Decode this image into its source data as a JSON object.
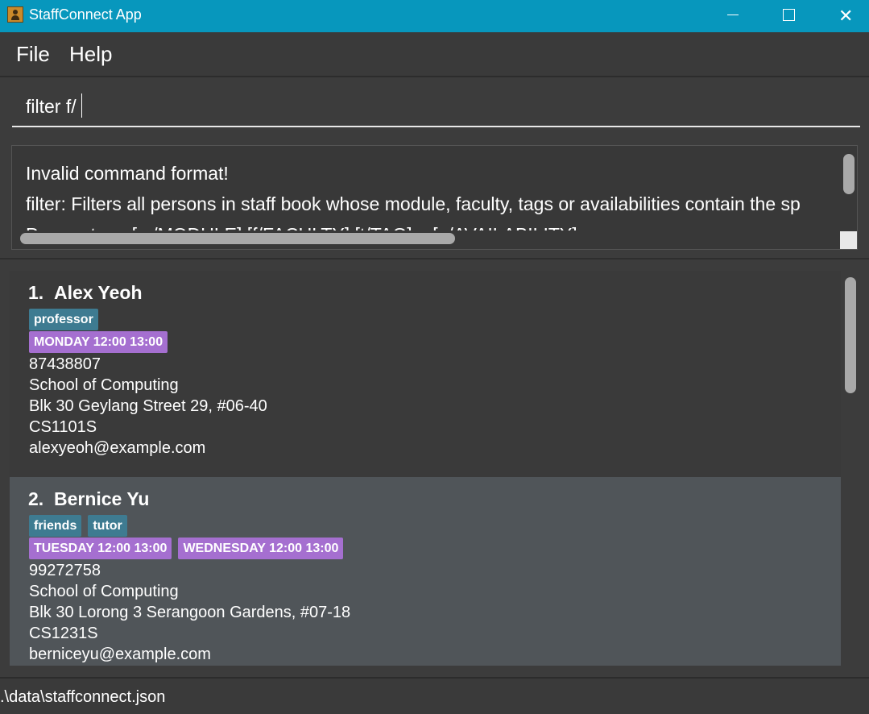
{
  "window": {
    "title": "StaffConnect App"
  },
  "menu": {
    "file": "File",
    "help": "Help"
  },
  "command": {
    "value": "filter f/"
  },
  "result": {
    "lines": [
      "Invalid command format!",
      "filter: Filters all persons in staff book whose module, faculty, tags or availabilities contain the sp",
      "Parameters: [m/MODULE] [f/FACULTY] [t/TAG]... [a/AVAILABILITY]..."
    ]
  },
  "persons": [
    {
      "index": "1.",
      "name": "Alex Yeoh",
      "tags": [
        "professor"
      ],
      "availabilities": [
        "MONDAY 12:00 13:00"
      ],
      "phone": "87438807",
      "faculty": "School of Computing",
      "address": "Blk 30 Geylang Street 29, #06-40",
      "module": "CS1101S",
      "email": "alexyeoh@example.com"
    },
    {
      "index": "2.",
      "name": "Bernice Yu",
      "tags": [
        "friends",
        "tutor"
      ],
      "availabilities": [
        "TUESDAY 12:00 13:00",
        "WEDNESDAY 12:00 13:00"
      ],
      "phone": "99272758",
      "faculty": "School of Computing",
      "address": "Blk 30 Lorong 3 Serangoon Gardens, #07-18",
      "module": "CS1231S",
      "email": "berniceyu@example.com"
    }
  ],
  "status": {
    "path": ".\\data\\staffconnect.json"
  },
  "colors": {
    "titlebar": "#0797bd",
    "tag": "#3e7b91",
    "availability": "#a56fd0",
    "selected_card": "#505559"
  },
  "icons": {
    "app": "address-book-icon",
    "minimize": "minimize-icon",
    "maximize": "maximize-icon",
    "close": "close-icon"
  }
}
